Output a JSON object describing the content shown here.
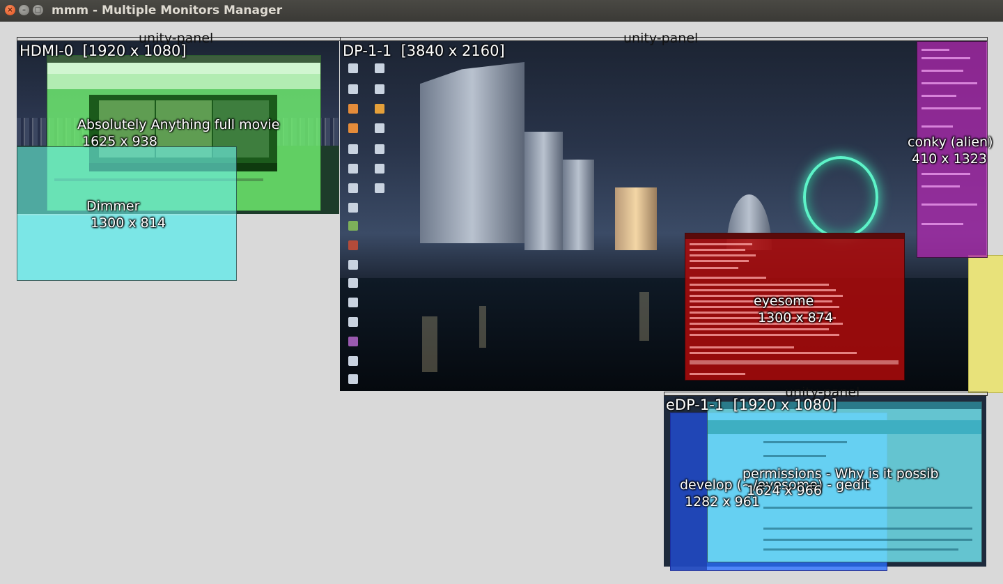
{
  "window": {
    "title": "mmm - Multiple Monitors Manager",
    "buttons": {
      "close": "×",
      "minimize": "–",
      "maximize": "□"
    }
  },
  "panels": [
    {
      "label": "unity-panel"
    },
    {
      "label": "unity-panel"
    },
    {
      "label": "unity-panel"
    }
  ],
  "monitors": [
    {
      "name": "HDMI-0",
      "resolution": "[1920 x 1080]",
      "label": "HDMI-0  [1920 x 1080]"
    },
    {
      "name": "DP-1-1",
      "resolution": "[3840 x 2160]",
      "label": "DP-1-1  [3840 x 2160]"
    },
    {
      "name": "eDP-1-1",
      "resolution": "[1920 x 1080]",
      "label": "eDP-1-1  [1920 x 1080]"
    }
  ],
  "windows": [
    {
      "title": "Absolutely Anything full movie",
      "size": "1625 x 938",
      "color": "#70f070"
    },
    {
      "title": "Dimmer",
      "size": "1300 x 814",
      "color": "#6eeee8"
    },
    {
      "title": "conky (alien)",
      "size": "410 x 1323",
      "color": "#aa28aa"
    },
    {
      "title": "eyesome",
      "size": "1300 x 874",
      "color": "#aa0a0a"
    },
    {
      "title": "develop (~/eyesome) - gedit",
      "size": "1282 x 961",
      "color": "#286eff"
    },
    {
      "title": "permissions - Why is it possib",
      "size": "1624 x 966",
      "color": "#78f0fa"
    }
  ]
}
